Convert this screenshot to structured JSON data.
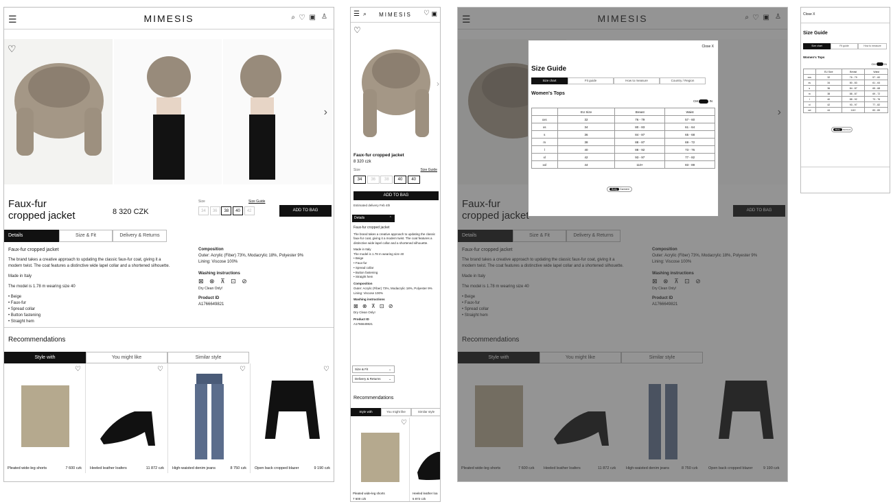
{
  "brand": "MIMESIS",
  "product": {
    "title_line1": "Faux-fur",
    "title_line2": "cropped jacket",
    "full_title": "Faux-fur cropped jacket",
    "price": "8 320 CZK",
    "price_mobile": "8 320 czk",
    "size_label": "Size",
    "size_guide": "Size Guide",
    "sizes": [
      "34",
      "36",
      "38",
      "40",
      "42"
    ],
    "add_to_bag": "ADD TO BAG",
    "delivery": "Estimated delivery Feb 4th"
  },
  "tabs": [
    "Details",
    "Size & Fit",
    "Delivery & Returns"
  ],
  "details": {
    "heading": "Faux-fur cropped jacket",
    "desc": "The brand takes a creative approach to updating the classic faux-fur coat, giving it a modern twist. The coat features a distinctive wide lapel collar and a shortened silhouette.",
    "made": "Made in Italy",
    "model": "The model is 1.78 m wearing size 40",
    "bullets": [
      "Beige",
      "Faux-fur",
      "Spread collar",
      "Button fastening",
      "Straight hem"
    ],
    "composition_h": "Composition",
    "composition": "Outer: Acrylic (Fiber) 73%, Modacrylic 18%, Polyester 9%",
    "lining": "Lining: Viscose 100%",
    "washing_h": "Washing instructions",
    "washing_note": "Dry Clean Only!",
    "pid_h": "Product ID",
    "pid": "A1766649821"
  },
  "reco": {
    "title": "Recommendations",
    "tabs": [
      "Style with",
      "You might like",
      "Similar style"
    ],
    "items": [
      {
        "name": "Pleated wide-leg shorts",
        "price": "7 600 czk"
      },
      {
        "name": "Heeled leather loafers",
        "price": "11 872 czk"
      },
      {
        "name": "High-waisted denim jeans",
        "price": "8 750 czk"
      },
      {
        "name": "Open back cropped blazer",
        "price": "9 190 czk"
      }
    ]
  },
  "mobile": {
    "details_tab": "Details",
    "size_fit": "Size & Fit",
    "delivery_returns": "Delivery & Returns",
    "loafer_name": "Heeled leather loa",
    "loafer_price": "5 872 czk"
  },
  "sizeguide": {
    "close": "Close X",
    "title": "Size Guide",
    "tabs": [
      "Size chart",
      "Fit guide",
      "How to measure",
      "Country / Region"
    ],
    "section": "Women's Tops",
    "unit_cm": "CM",
    "unit_in": "IN",
    "headers": [
      "",
      "EU Size",
      "Breast",
      "Waist"
    ],
    "rows": [
      [
        "xxs",
        "32",
        "76 - 79",
        "57 - 60"
      ],
      [
        "xs",
        "34",
        "80 - 83",
        "61 - 64"
      ],
      [
        "s",
        "36",
        "84 - 87",
        "65 - 68"
      ],
      [
        "m",
        "38",
        "88 - 87",
        "69 - 72"
      ],
      [
        "l",
        "40",
        "88 - 92",
        "73 - 76"
      ],
      [
        "xl",
        "42",
        "93 - 97",
        "77 - 82"
      ],
      [
        "xxl",
        "44",
        "110+",
        "83 - 89"
      ]
    ],
    "toggle": [
      "Body",
      "Garment"
    ]
  }
}
